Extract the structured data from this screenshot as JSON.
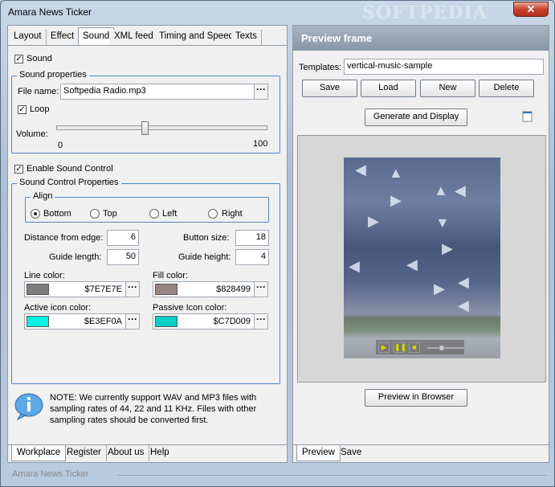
{
  "window": {
    "title": "Amara News Ticker",
    "watermark": "SOFTPEDIA",
    "close_label": "✕"
  },
  "left": {
    "tabs": [
      "Layout",
      "Effect",
      "Sound",
      "XML feed",
      "Timing and Speed",
      "Texts"
    ],
    "active_tab": "Sound",
    "sound_checkbox": {
      "label": "Sound",
      "checked": true
    },
    "sound_properties": {
      "title": "Sound properties",
      "file_name_label": "File name:",
      "file_name_value": "Softpedia Radio.mp3",
      "browse_label": "···",
      "loop_label": "Loop",
      "loop_checked": true,
      "volume_label": "Volume:",
      "volume_min": "0",
      "volume_max": "100",
      "volume_value": 42
    },
    "enable_sound_control": {
      "label": "Enable Sound Control",
      "checked": true
    },
    "sound_control": {
      "title": "Sound Control  Properties",
      "align": {
        "title": "Align",
        "options": [
          "Bottom",
          "Top",
          "Left",
          "Right"
        ],
        "selected": "Bottom"
      },
      "distance_from_edge_label": "Distance from edge:",
      "distance_from_edge_value": "6",
      "button_size_label": "Button size:",
      "button_size_value": "18",
      "guide_length_label": "Guide length:",
      "guide_length_value": "50",
      "guide_height_label": "Guide height:",
      "guide_height_value": "4",
      "line_color_label": "Line color:",
      "line_color_value": "$7E7E7E",
      "line_color_hex": "#7E7E7E",
      "fill_color_label": "Fill color:",
      "fill_color_value": "$828499",
      "fill_color_hex": "#998482",
      "active_icon_color_label": "Active icon color:",
      "active_icon_color_value": "$E3EF0A",
      "active_icon_color_hex": "#0AEFE3",
      "passive_icon_color_label": "Passive Icon color:",
      "passive_icon_color_value": "$C7D009",
      "passive_icon_color_hex": "#09D0C7",
      "dots_label": "···"
    },
    "note": "NOTE: We currently support WAV and MP3 files with sampling rates of 44, 22 and 11 KHz. Files with other sampling rates should be converted first.",
    "bottom_tabs": [
      "Workplace",
      "Register",
      "About us",
      "Help"
    ],
    "active_bottom_tab": "Workplace"
  },
  "right": {
    "header": "Preview frame",
    "templates_label": "Templates:",
    "templates_value": "vertical-music-sample",
    "buttons": {
      "save": "Save",
      "load": "Load",
      "new": "New",
      "delete": "Delete"
    },
    "generate_button": "Generate and Display",
    "preview_browser_button": "Preview in Browser",
    "bottom_tabs": [
      "Preview",
      "Save"
    ],
    "active_bottom_tab": "Preview"
  },
  "status": {
    "text": "Amara News Ticker"
  }
}
